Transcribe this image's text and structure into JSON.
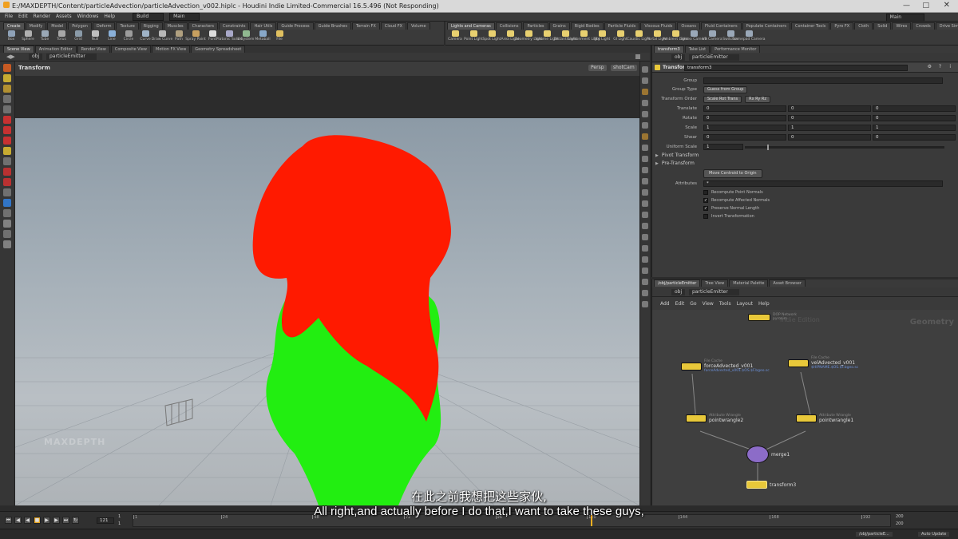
{
  "window": {
    "title": "E:/MAXDEPTH/Content/particleAdvection/particleAdvection_v002.hiplc - Houdini Indie Limited-Commercial 16.5.496 (Not Responding)"
  },
  "menubar": {
    "items": [
      "File",
      "Edit",
      "Render",
      "Assets",
      "Windows",
      "Help"
    ],
    "build_label": "Build",
    "main_label": "Main",
    "desktop_label": "Main"
  },
  "shelf_left": {
    "tabs": [
      "Create",
      "Modify",
      "Model",
      "Polygon",
      "Deform",
      "Texture",
      "Rigging",
      "Muscles",
      "Characters",
      "Constraints",
      "Hair Utils",
      "Guide Process",
      "Guide Brushes",
      "Terrain FX",
      "Cloud FX",
      "Volume"
    ],
    "tools": [
      "Box",
      "Sphere",
      "Tube",
      "Torus",
      "Grid",
      "Null",
      "Line",
      "Circle",
      "Curve",
      "Draw Curve",
      "Path",
      "Spray Paint",
      "Font",
      "Platonic Solids",
      "L-System",
      "Metaball",
      "File"
    ]
  },
  "shelf_right": {
    "tabs": [
      "Lights and Cameras",
      "Collisions",
      "Particles",
      "Grains",
      "Rigid Bodies",
      "Particle Fluids",
      "Viscous Fluids",
      "Oceans",
      "Fluid Containers",
      "Populate Containers",
      "Container Tools",
      "Pyro FX",
      "Cloth",
      "Solid",
      "Wires",
      "Crowds",
      "Drive Simulation"
    ],
    "tools": [
      "Camera",
      "Point Light",
      "Spot Light",
      "Area Light",
      "Geometry Light",
      "Volume Light",
      "Distant Light",
      "Environment Light",
      "Sky Light",
      "GI Light",
      "Caustic Light",
      "Portal Light",
      "Ambient Light",
      "Stereo Camera",
      "VR Camera",
      "Switcher",
      "Gamepad Camera"
    ]
  },
  "viewer": {
    "tabs": [
      "Scene View",
      "Animation Editor",
      "Render View",
      "Composite View",
      "Motion FX View",
      "Geometry Spreadsheet"
    ],
    "path": [
      "obj",
      "particleEmitter"
    ],
    "label": "Transform",
    "persp_label": "Persp",
    "cam_label": "shotCam",
    "watermark": "MAXDEPTH"
  },
  "params": {
    "tabs": [
      "transform3",
      "Take List",
      "Performance Monitor"
    ],
    "path": [
      "obj",
      "particleEmitter"
    ],
    "node_type": "Transform",
    "node_name": "transform3",
    "group_label": "Group",
    "group_type_label": "Group Type",
    "group_type_value": "Guess from Group",
    "xform_order_label": "Transform Order",
    "xform_order_value": "Scale Rot Trans",
    "rot_order_value": "Rx Ry Rz",
    "rows": [
      {
        "label": "Translate",
        "values": [
          "0",
          "0",
          "0"
        ]
      },
      {
        "label": "Rotate",
        "values": [
          "0",
          "0",
          "0"
        ]
      },
      {
        "label": "Scale",
        "values": [
          "1",
          "1",
          "1"
        ]
      },
      {
        "label": "Shear",
        "values": [
          "0",
          "0",
          "0"
        ]
      }
    ],
    "uniform_scale_label": "Uniform Scale",
    "uniform_scale_value": "1",
    "pivot_label": "Pivot Transform",
    "pre_label": "Pre-Transform",
    "move_centroid_label": "Move Centroid to Origin",
    "attributes_label": "Attributes",
    "attributes_value": "*",
    "checks": [
      {
        "label": "Recompute Point Normals",
        "checked": false
      },
      {
        "label": "Recompute Affected Normals",
        "checked": true
      },
      {
        "label": "Preserve Normal Length",
        "checked": true
      },
      {
        "label": "Invert Transformation",
        "checked": false
      }
    ]
  },
  "network": {
    "tabs": [
      "/obj/particleEmitter",
      "Tree View",
      "Material Palette",
      "Asset Browser"
    ],
    "path": [
      "obj",
      "particleEmitter"
    ],
    "menu": [
      "Add",
      "Edit",
      "Go",
      "View",
      "Tools",
      "Layout",
      "Help"
    ],
    "context_label": "Geometry",
    "edition_label": "Indie Edition",
    "nodes": {
      "top_type": "DOP Network",
      "top_name": "pyrosim",
      "force_type": "File Cache",
      "force_name": "forceAdvected_v001",
      "force_file": "forceAdvected_v001.$OS.$F.bgeo.sc",
      "vel_type": "File Cache",
      "vel_name": "velAdvected_v001",
      "vel_file": "$HIPNAME.$OS.$F.bgeo.sc",
      "pw2_type": "Attribute Wrangle",
      "pw2_name": "pointwrangle2",
      "pw1_type": "Attribute Wrangle",
      "pw1_name": "pointwrangle1",
      "merge_name": "merge1",
      "xform_name": "transform3"
    }
  },
  "timeline": {
    "frame": "121",
    "start": "1",
    "start2": "1",
    "ticks": [
      "1",
      "24",
      "48",
      "72",
      "96",
      "120",
      "144",
      "168",
      "192"
    ],
    "end": "200",
    "end2": "200",
    "status_path": "/obj/particleE...",
    "update_mode": "Auto Update"
  },
  "subtitles": {
    "cn": "在此之前我想把这些家伙,",
    "en": "All right,and actually before I do that,I want to take these guys,"
  },
  "colors": {
    "smoke_red": "#ff1a00",
    "smoke_green": "#22ee11",
    "node_yellow": "#e8c83a",
    "merge_purple": "#8c6cc8"
  }
}
